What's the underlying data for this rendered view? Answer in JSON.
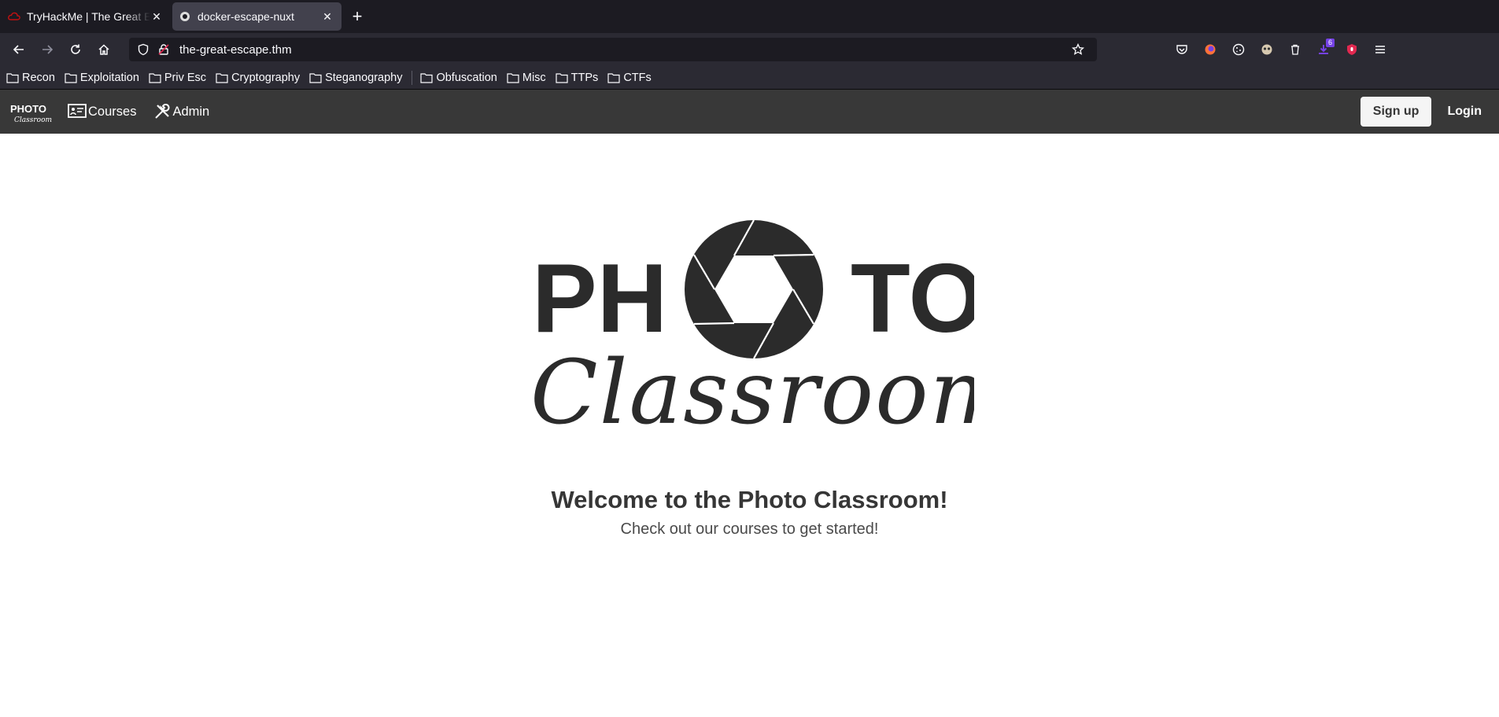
{
  "browser": {
    "tabs": [
      {
        "title": "TryHackMe | The Great Escape",
        "active": false,
        "favicon": "tryhackme-cloud-icon"
      },
      {
        "title": "docker-escape-nuxt",
        "active": true,
        "favicon": "circle-favicon-icon"
      }
    ],
    "url": "the-great-escape.thm",
    "extension_badge": "6",
    "bookmarks": [
      "Recon",
      "Exploitation",
      "Priv Esc",
      "Cryptography",
      "Steganography",
      "Obfuscation",
      "Misc",
      "TTPs",
      "CTFs"
    ]
  },
  "site": {
    "logo_top": "PHOTO",
    "logo_script": "Classroom",
    "nav": {
      "courses": "Courses",
      "admin": "Admin"
    },
    "signup": "Sign up",
    "login": "Login"
  },
  "hero": {
    "title": "Welcome to the Photo Classroom!",
    "subtitle": "Check out our courses to get started!"
  },
  "colors": {
    "header_bg": "#383838",
    "text_dark": "#363636",
    "logo": "#2b2b2b"
  }
}
